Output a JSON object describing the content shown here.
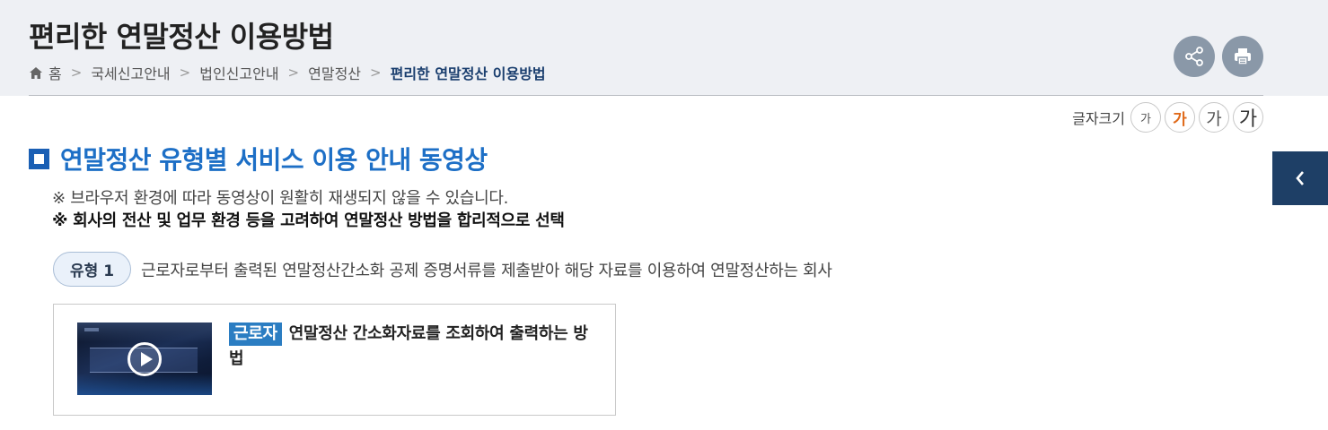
{
  "header": {
    "title": "편리한 연말정산 이용방법",
    "breadcrumb": [
      "홈",
      "국세신고안내",
      "법인신고안내",
      "연말정산",
      "편리한 연말정산 이용방법"
    ],
    "share_icon": "share-icon",
    "print_icon": "print-icon"
  },
  "font_size": {
    "label": "글자크기",
    "buttons": [
      "가",
      "가",
      "가",
      "가"
    ]
  },
  "side_tab": {
    "icon": "chevron-left-icon"
  },
  "section": {
    "title": "연말정산 유형별 서비스 이용 안내 동영상",
    "notice1": "※ 브라우저 환경에 따라 동영상이 원활히 재생되지 않을 수 있습니다.",
    "notice2": "※ 회사의 전산 및 업무 환경 등을 고려하여 연말정산 방법을 합리적으로 선택"
  },
  "type": {
    "badge": "유형 1",
    "description": "근로자로부터 출력된 연말정산간소화 공제 증명서류를 제출받아 해당 자료를 이용하여 연말정산하는 회사"
  },
  "video": {
    "tag": "근로자",
    "title": "연말정산 간소화자료를 조회하여 출력하는 방법",
    "thumbnail_icon": "play-icon"
  },
  "colors": {
    "header_bg": "#eef0f4",
    "title_blue": "#1d6fc6",
    "accent_orange": "#e06a1a",
    "side_tab": "#1e3f66",
    "tag_blue": "#2b7dc2"
  }
}
